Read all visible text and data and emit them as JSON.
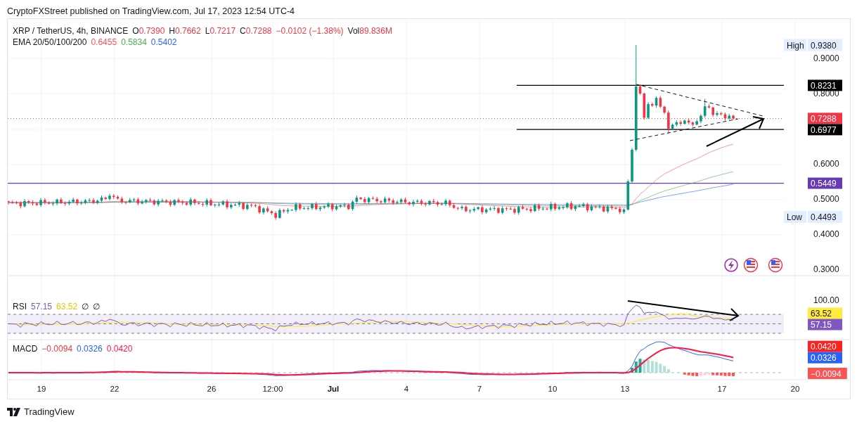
{
  "publisher": "CryptoFXStreet published on TradingView.com, Jul 17, 2023 12:54 UTC-4",
  "legend": {
    "symbol": "XRP / TetherUS, 4h, BINANCE",
    "falling": true,
    "ohlc": [
      {
        "label": "O",
        "value": "0.7390"
      },
      {
        "label": "H",
        "value": "0.7662"
      },
      {
        "label": "L",
        "value": "0.7217"
      },
      {
        "label": "C",
        "value": "0.7288"
      }
    ],
    "change": "−0.0102 (−1.38%)",
    "volume_label": "Vol",
    "volume": "89.836M"
  },
  "ema": {
    "label": "EMA 20/50/100/200",
    "values": [
      {
        "value": "0.6455",
        "color": "#f7525f"
      },
      {
        "value": "0.5834",
        "color": "#4caf50"
      },
      {
        "value": "0.5402",
        "color": "#2962ff"
      }
    ]
  },
  "price_axis": [
    {
      "kind": "extreme",
      "tag": "High",
      "value": "0.9380"
    },
    {
      "kind": "tick",
      "value": "0.9000"
    },
    {
      "kind": "level",
      "value": "0.8231",
      "color": "#000000"
    },
    {
      "kind": "tick",
      "value": "0.8000"
    },
    {
      "kind": "price",
      "value": "0.7288",
      "color": "#f23645"
    },
    {
      "kind": "level",
      "value": "0.6977",
      "color": "#000000"
    },
    {
      "kind": "tick",
      "value": "0.6000"
    },
    {
      "kind": "horizontal",
      "value": "0.5449",
      "color": "#673ab7"
    },
    {
      "kind": "tick",
      "value": "0.5000"
    },
    {
      "kind": "extreme",
      "tag": "Low",
      "value": "0.4493"
    },
    {
      "kind": "tick",
      "value": "0.4000"
    },
    {
      "kind": "tick",
      "value": "0.3000"
    }
  ],
  "rsi": {
    "label": "RSI",
    "values": [
      {
        "value": "57.15",
        "color": "#7e57c2"
      },
      {
        "value": "63.52",
        "color": "#e8c600"
      }
    ],
    "flags": [
      "∅",
      "∅"
    ]
  },
  "rsi_axis": [
    {
      "kind": "tick",
      "value": "100.00"
    },
    {
      "kind": "badge",
      "value": "63.52",
      "color": "#ffeb3b"
    },
    {
      "kind": "badge",
      "value": "57.15",
      "color": "#7e57c2"
    }
  ],
  "macd": {
    "label": "MACD",
    "values": [
      {
        "value": "−0.0094",
        "color": "#f23645"
      },
      {
        "value": "0.0326",
        "color": "#2962ff"
      },
      {
        "value": "0.0420",
        "color": "#ff1744"
      }
    ]
  },
  "macd_axis": [
    {
      "kind": "badge",
      "value": "0.0420",
      "color": "#ff2020"
    },
    {
      "kind": "badge",
      "value": "0.0326",
      "color": "#2962ff"
    },
    {
      "kind": "badge",
      "value": "−0.0094",
      "color": "#ff5252"
    }
  ],
  "time_axis": [
    {
      "label": "19",
      "bold": false
    },
    {
      "label": "22",
      "bold": false
    },
    {
      "label": "26",
      "bold": false
    },
    {
      "label": "12:00",
      "bold": false
    },
    {
      "label": "Jul",
      "bold": true
    },
    {
      "label": "4",
      "bold": false
    },
    {
      "label": "7",
      "bold": false
    },
    {
      "label": "10",
      "bold": false
    },
    {
      "label": "13",
      "bold": false
    },
    {
      "label": "17",
      "bold": false
    },
    {
      "label": "20",
      "bold": false
    }
  ],
  "footer": {
    "brand": "TradingView"
  }
}
